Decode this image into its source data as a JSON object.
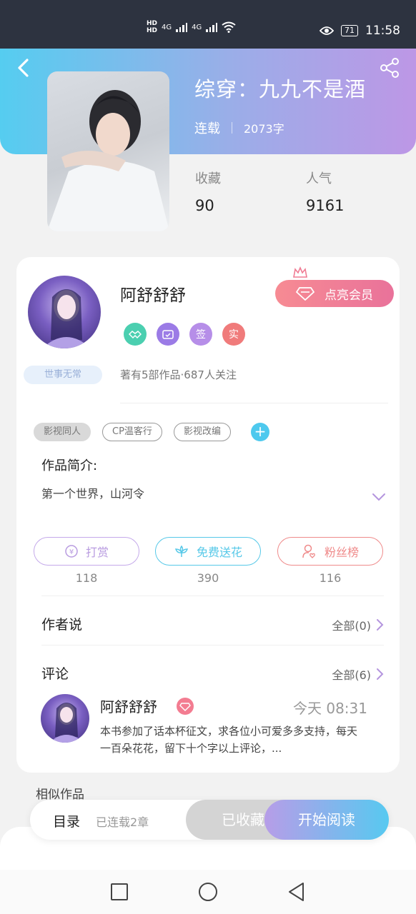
{
  "status_bar": {
    "network_hd1": "HD",
    "network_hd2": "HD",
    "signal1": "4G",
    "signal2": "4G",
    "battery": "71",
    "time": "11:58",
    "icons": [
      "eye-icon",
      "wifi-icon",
      "signal-icon"
    ]
  },
  "book": {
    "title": "综穿：九九不是酒",
    "status": "连载",
    "word_count": "2073字",
    "stats": {
      "favorites_label": "收藏",
      "favorites_value": "90",
      "popularity_label": "人气",
      "popularity_value": "9161"
    }
  },
  "author": {
    "name": "阿舒舒舒",
    "vip_button": "点亮会员",
    "badges": [
      "",
      "",
      "签",
      "实"
    ],
    "motto": "世事无常",
    "works_info": "著有5部作品·687人关注"
  },
  "tags": [
    "影视同人",
    "CP温客行",
    "影视改编"
  ],
  "intro": {
    "label": "作品简介:",
    "text": "第一个世界，山河令"
  },
  "actions": [
    {
      "label": "打赏",
      "count": "118",
      "color": "#b89be0"
    },
    {
      "label": "免费送花",
      "count": "390",
      "color": "#56c8e8"
    },
    {
      "label": "粉丝榜",
      "count": "116",
      "color": "#ef8a8a"
    }
  ],
  "author_says": {
    "label": "作者说",
    "more": "全部(0)"
  },
  "comments": {
    "label": "评论",
    "more": "全部(6)",
    "first": {
      "name": "阿舒舒舒",
      "time": "今天 08:31",
      "text": "本书参加了话本杯征文，求各位小可爱多多支持，每天一百朵花花，留下十个字以上评论，..."
    }
  },
  "similar": {
    "label": "相似作品"
  },
  "bottom_bar": {
    "toc": "目录",
    "chapters": "已连载2章",
    "collected": "已收藏",
    "read": "开始阅读"
  },
  "colors": {
    "header_start": "#55cdf0",
    "header_end": "#bd97e6",
    "vip": "#f37c91",
    "accent": "#57c9f0"
  }
}
